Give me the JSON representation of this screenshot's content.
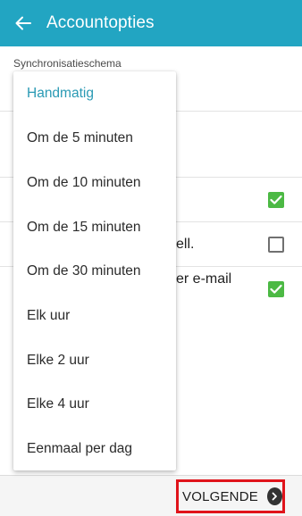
{
  "appbar": {
    "title": "Accountopties",
    "background": "#22a5c2"
  },
  "settings": {
    "section_label": "Synchronisatieschema",
    "row_notify_partial": "ell.",
    "row_email_partial": "er e-mail",
    "checkbox_row1_checked": true,
    "checkbox_row2_checked": false,
    "checkbox_row3_checked": true
  },
  "dropdown": {
    "items": [
      {
        "label": "Handmatig",
        "selected": true
      },
      {
        "label": "Om de 5 minuten",
        "selected": false
      },
      {
        "label": "Om de 10 minuten",
        "selected": false
      },
      {
        "label": "Om de 15 minuten",
        "selected": false
      },
      {
        "label": "Om de 30 minuten",
        "selected": false
      },
      {
        "label": "Elk uur",
        "selected": false
      },
      {
        "label": "Elke 2 uur",
        "selected": false
      },
      {
        "label": "Elke 4 uur",
        "selected": false
      },
      {
        "label": "Eenmaal per dag",
        "selected": false
      }
    ],
    "selected_color": "#2a9ab4"
  },
  "bottombar": {
    "next_label": "VOLGENDE",
    "highlight_color": "#e0141b"
  },
  "icons": {
    "back": "arrow-left-icon",
    "next": "chevron-right-circle-icon",
    "check": "check-icon"
  }
}
